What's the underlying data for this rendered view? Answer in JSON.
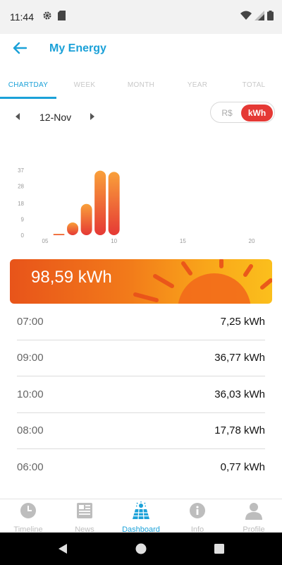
{
  "status": {
    "time": "11:44"
  },
  "header": {
    "title": "My Energy"
  },
  "tabs": [
    {
      "label": "CHARTDAY",
      "active": true
    },
    {
      "label": "WEEK",
      "active": false
    },
    {
      "label": "MONTH",
      "active": false
    },
    {
      "label": "YEAR",
      "active": false
    },
    {
      "label": "TOTAL",
      "active": false
    }
  ],
  "date_nav": {
    "date": "12-Nov"
  },
  "unit_toggle": {
    "option_1": "R$",
    "option_2": "kWh",
    "selected": "kWh",
    "accent": "#e53935"
  },
  "chart_data": {
    "type": "bar",
    "x": [
      6,
      7,
      8,
      9,
      10
    ],
    "values": [
      0.77,
      7.25,
      17.78,
      36.77,
      36.03
    ],
    "x_ticks": [
      "05",
      "10",
      "15",
      "20"
    ],
    "y_ticks": [
      "37",
      "28",
      "18",
      "9",
      "0"
    ],
    "xlim": [
      5,
      20
    ],
    "ylim": [
      0,
      37
    ],
    "xlabel": "",
    "ylabel": "",
    "grid": false,
    "colors": {
      "bar_top": "#f9a03a",
      "bar_bottom": "#e53935"
    }
  },
  "total": {
    "value": "98,59 kWh"
  },
  "entries": [
    {
      "time": "07:00",
      "value": "7,25 kWh"
    },
    {
      "time": "09:00",
      "value": "36,77 kWh"
    },
    {
      "time": "10:00",
      "value": "36,03 kWh"
    },
    {
      "time": "08:00",
      "value": "17,78 kWh"
    },
    {
      "time": "06:00",
      "value": "0,77 kWh"
    }
  ],
  "bottom_nav": [
    {
      "label": "Timeline",
      "icon": "clock-icon",
      "active": false
    },
    {
      "label": "News",
      "icon": "newspaper-icon",
      "active": false
    },
    {
      "label": "Dashboard",
      "icon": "solar-panel-icon",
      "active": true
    },
    {
      "label": "Info",
      "icon": "info-icon",
      "active": false
    },
    {
      "label": "Profile",
      "icon": "person-icon",
      "active": false
    }
  ],
  "colors": {
    "accent": "#1ba1d8",
    "inactive": "#bdbdbd"
  }
}
